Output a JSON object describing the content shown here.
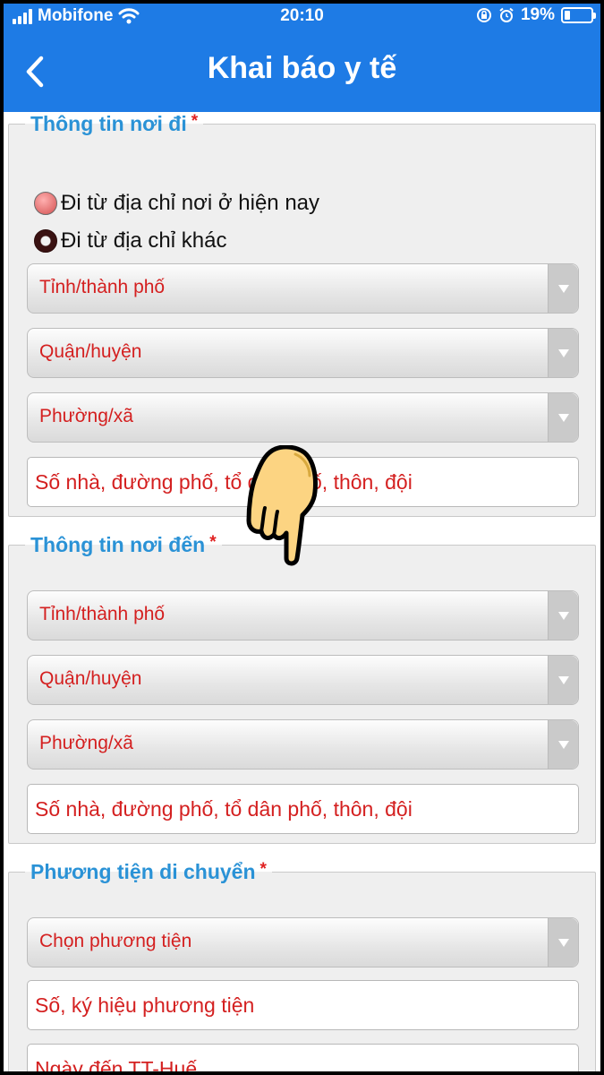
{
  "status_bar": {
    "carrier": "Mobifone",
    "time": "20:10",
    "battery": "19%",
    "icons": [
      "signal-icon",
      "wifi-icon",
      "rotation-lock-icon",
      "alarm-icon",
      "battery-icon"
    ]
  },
  "header": {
    "title": "Khai báo y tế",
    "back_icon": "chevron-left-icon",
    "background": "#1e7be5"
  },
  "required_mark": "*",
  "departure": {
    "legend": "Thông tin nơi đi",
    "radio_options": [
      "Đi từ địa chỉ nơi ở hiện nay",
      "Đi từ địa chỉ khác"
    ],
    "selected_option": "Đi từ địa chỉ khác",
    "province": "Tỉnh/thành phố",
    "district": "Quận/huyện",
    "ward": "Phường/xã",
    "address_placeholder": "Số nhà, đường phố, tổ dân phố, thôn, đội"
  },
  "arrival": {
    "legend": "Thông tin nơi đến",
    "province": "Tỉnh/thành phố",
    "district": "Quận/huyện",
    "ward": "Phường/xã",
    "address_placeholder": "Số nhà, đường phố, tổ dân phố, thôn, đội"
  },
  "transport": {
    "legend": "Phương tiện di chuyển",
    "vehicle_select": "Chọn phương tiện",
    "vehicle_number_placeholder": "Số, ký hiệu phương tiện",
    "arrival_date_placeholder": "Ngày đến TT-Huế"
  },
  "colors": {
    "legend": "#2a92d6",
    "placeholder": "#d42020",
    "required": "#e02020"
  }
}
